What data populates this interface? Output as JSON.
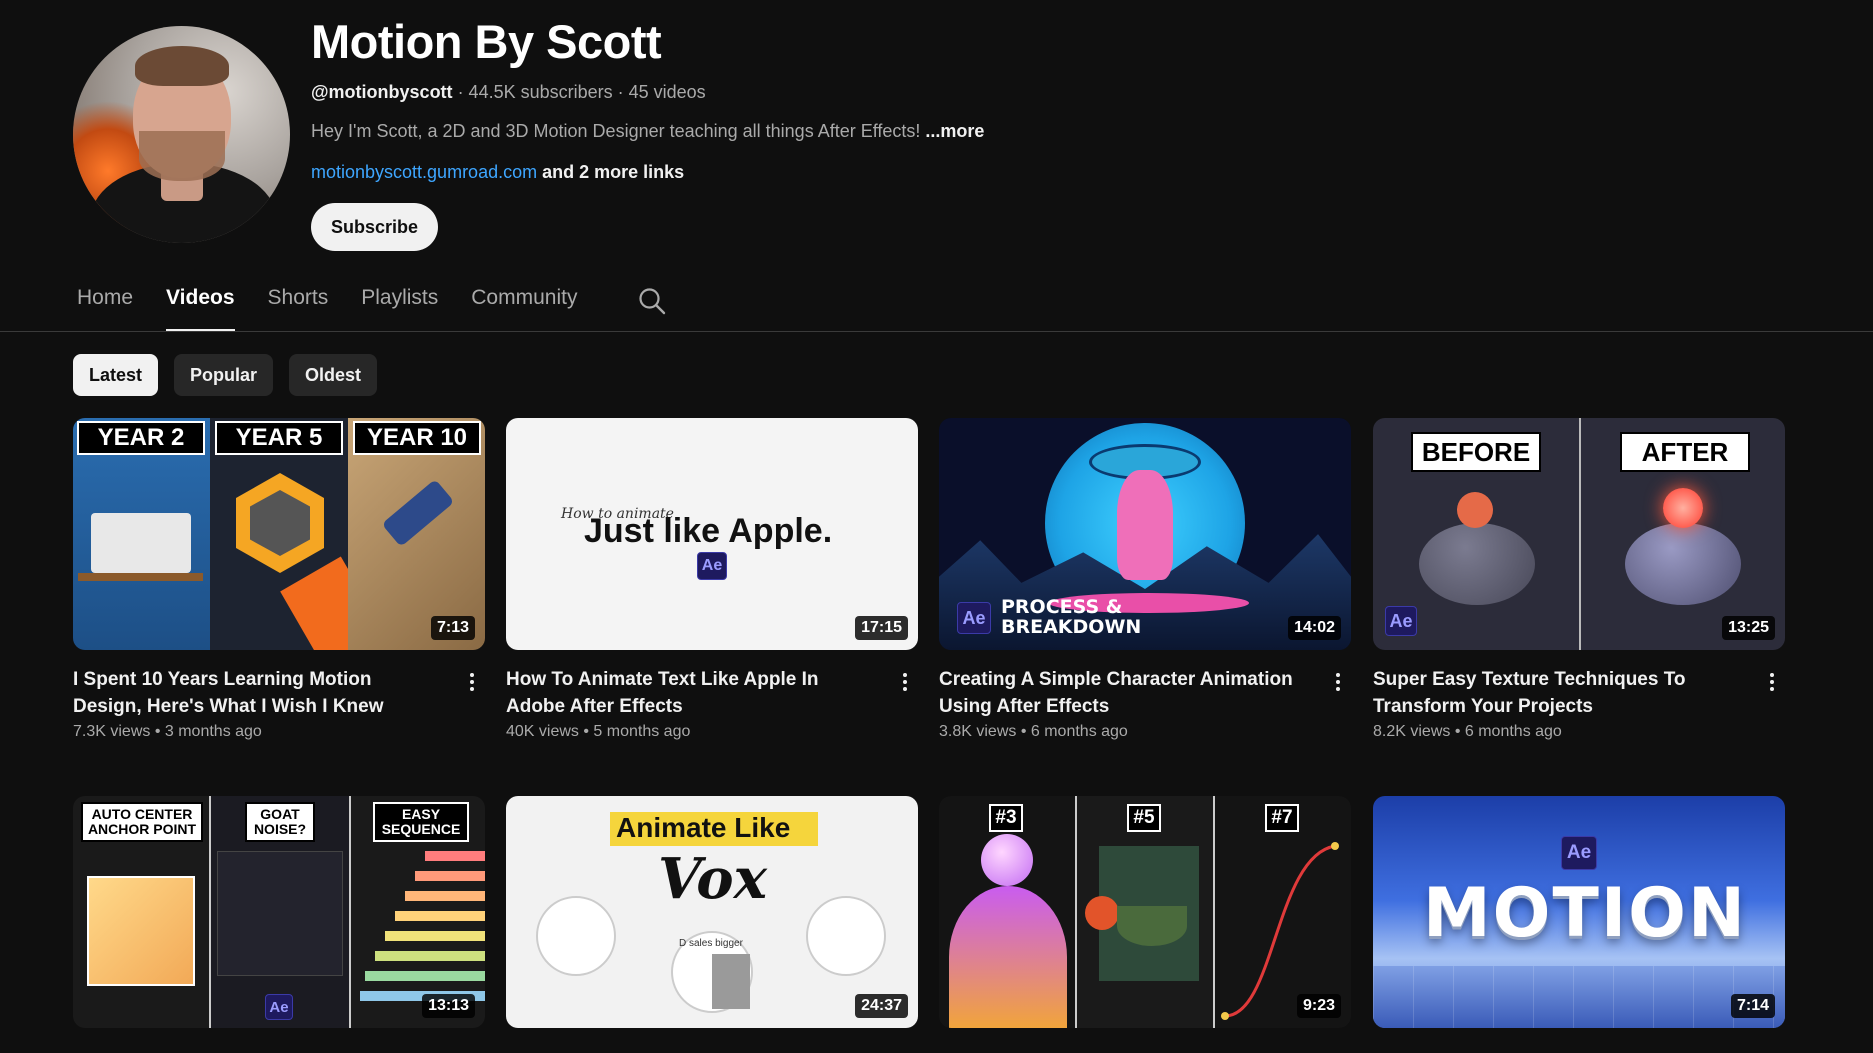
{
  "channel": {
    "name": "Motion By Scott",
    "handle": "@motionbyscott",
    "stats": " · 44.5K subscribers · 45 videos",
    "description": "Hey I'm Scott, a 2D and 3D Motion Designer teaching all things After Effects! ",
    "more": "...more",
    "link": "motionbyscott.gumroad.com",
    "more_links": " and 2 more links",
    "subscribe_label": "Subscribe"
  },
  "tabs": [
    {
      "label": "Home"
    },
    {
      "label": "Videos"
    },
    {
      "label": "Shorts"
    },
    {
      "label": "Playlists"
    },
    {
      "label": "Community"
    }
  ],
  "chips": [
    {
      "label": "Latest"
    },
    {
      "label": "Popular"
    },
    {
      "label": "Oldest"
    }
  ],
  "videos": [
    {
      "title": "I Spent 10 Years Learning Motion Design, Here's What I Wish I Knew",
      "views": "7.3K views",
      "age": "3 months ago",
      "duration": "7:13",
      "thumb_text": [
        "YEAR 2",
        "YEAR 5",
        "YEAR 10"
      ]
    },
    {
      "title": "How To Animate Text Like Apple In Adobe After Effects",
      "views": "40K views",
      "age": "5 months ago",
      "duration": "17:15",
      "thumb_text": [
        "How to animate",
        "Just like Apple.",
        "Ae"
      ]
    },
    {
      "title": "Creating A Simple Character Animation Using After Effects",
      "views": "3.8K views",
      "age": "6 months ago",
      "duration": "14:02",
      "thumb_text": [
        "PROCESS &",
        "BREAKDOWN",
        "Ae"
      ]
    },
    {
      "title": "Super Easy Texture Techniques To Transform Your Projects",
      "views": "8.2K views",
      "age": "6 months ago",
      "duration": "13:25",
      "thumb_text": [
        "BEFORE",
        "AFTER",
        "Ae"
      ]
    },
    {
      "duration": "13:13",
      "thumb_text": [
        "AUTO CENTER ANCHOR POINT",
        "GOAT NOISE?",
        "EASY SEQUENCE",
        "Ae"
      ]
    },
    {
      "duration": "24:37",
      "thumb_text": [
        "Animate Like",
        "Vox",
        "D sales bigger"
      ]
    },
    {
      "duration": "9:23",
      "thumb_text": [
        "#3",
        "#5",
        "#7"
      ]
    },
    {
      "duration": "7:14",
      "thumb_text": [
        "Ae",
        "MOTION"
      ]
    }
  ],
  "colors": {
    "background": "#0f0f0f",
    "link": "#3ea6ff",
    "chip_bg": "#272727",
    "text_secondary": "#aaaaaa"
  }
}
